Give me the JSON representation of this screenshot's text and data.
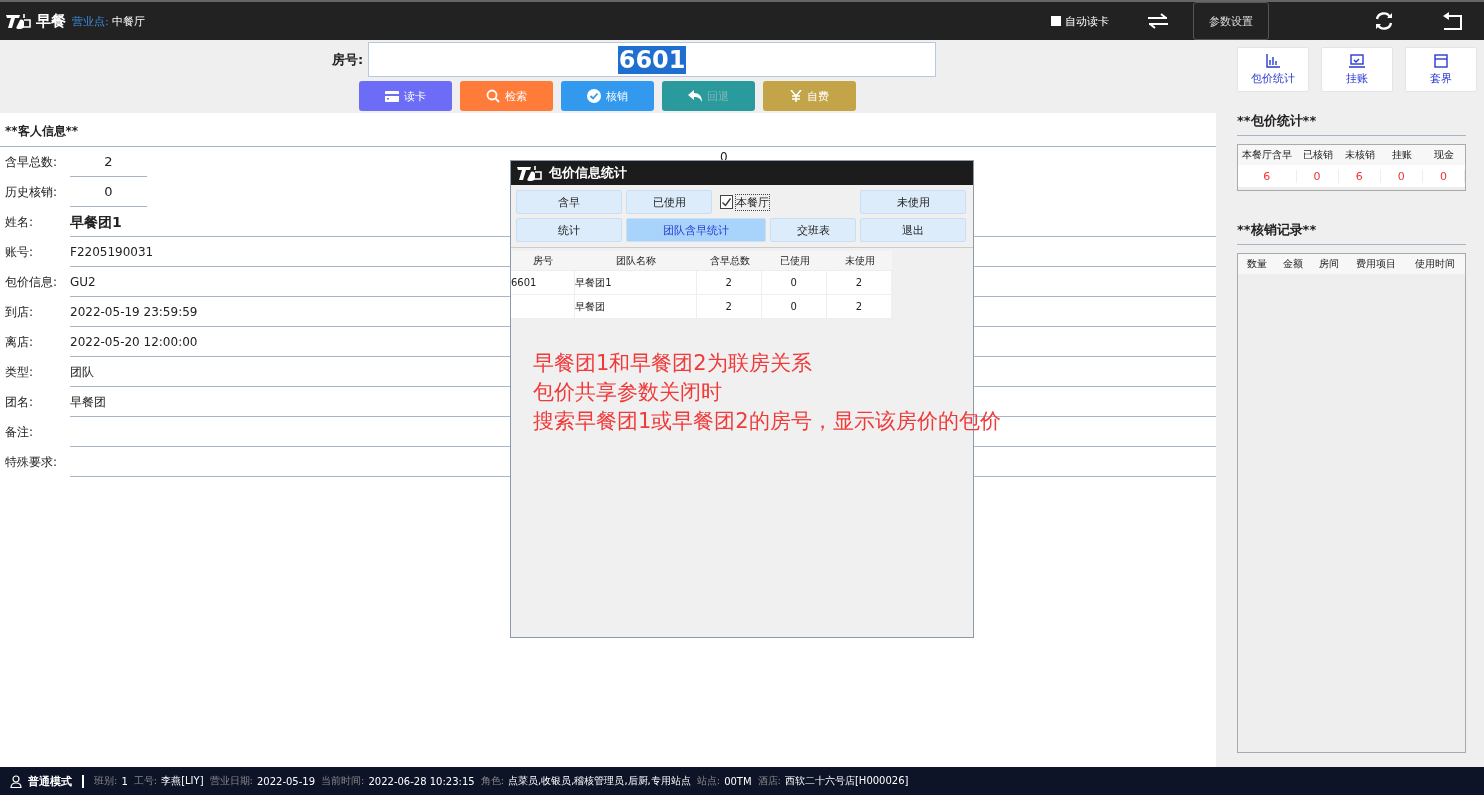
{
  "topbar": {
    "logo_text": "早餐",
    "outlet_label": "营业点:",
    "outlet": "中餐厅",
    "auto_read": {
      "label": "自动读卡",
      "checked": false
    },
    "settings_button": "参数设置"
  },
  "room": {
    "label": "房号:",
    "value": "6601"
  },
  "actions": [
    {
      "label": "读卡",
      "color": "#6c6cf7",
      "disabled": false
    },
    {
      "label": "检索",
      "color": "#ff7b3a",
      "disabled": false
    },
    {
      "label": "核销",
      "color": "#3399ee",
      "disabled": false
    },
    {
      "label": "回退",
      "color": "#2b9a9c",
      "disabled": true
    },
    {
      "label": "自费",
      "color": "#c4a448",
      "disabled": false
    }
  ],
  "quick_buttons": [
    {
      "label": "包价统计"
    },
    {
      "label": "挂账"
    },
    {
      "label": "套界"
    }
  ],
  "guest_info": {
    "title": "**客人信息**",
    "counters": [
      {
        "label": "含早总数:",
        "value": "2"
      },
      {
        "label": "历史核销:",
        "value": "0"
      }
    ],
    "today": {
      "value": "0"
    },
    "fields": [
      {
        "label": "姓名:",
        "value": "早餐团1",
        "kind": "bold"
      },
      {
        "label": "账号:",
        "value": "F2205190031",
        "kind": "plain"
      },
      {
        "label": "包价信息:",
        "value": "GU2",
        "kind": "plain"
      },
      {
        "label": "到店:",
        "value": "2022-05-19 23:59:59",
        "kind": "plain"
      },
      {
        "label": "离店:",
        "value": "2022-05-20 12:00:00",
        "kind": "plain"
      },
      {
        "label": "类型:",
        "value": "团队",
        "kind": "plain"
      },
      {
        "label": "团名:",
        "value": "早餐团",
        "kind": "plain"
      },
      {
        "label": "备注:",
        "kind": "plain"
      },
      {
        "label": "特殊要求:",
        "kind": "plain"
      }
    ]
  },
  "package_stats": {
    "title": "**包价统计**",
    "columns": [
      "本餐厅含早",
      "已核销",
      "未核销",
      "挂账",
      "现金"
    ],
    "values": [
      "6",
      "0",
      "6",
      "0",
      "0"
    ]
  },
  "writeoff_records": {
    "title": "**核销记录**",
    "columns": [
      "数量",
      "金额",
      "房间",
      "费用项目",
      "使用时间"
    ]
  },
  "dialog": {
    "title": "包价信息统计",
    "buttons": [
      {
        "label": "含早",
        "selected": false
      },
      {
        "label": "已使用",
        "selected": false
      },
      {
        "label": "未使用",
        "selected": false
      },
      {
        "label": "统计",
        "selected": false
      },
      {
        "label": "团队含早统计",
        "selected": true
      },
      {
        "label": "交班表",
        "selected": false
      },
      {
        "label": "退出",
        "selected": false
      }
    ],
    "checkbox": {
      "label": "本餐厅",
      "checked": true
    },
    "table": {
      "columns": [
        "房号",
        "团队名称",
        "含早总数",
        "已使用",
        "未使用"
      ],
      "rows": [
        [
          "6601",
          "早餐团1",
          "2",
          "0",
          "2"
        ],
        [
          "",
          "早餐团",
          "2",
          "0",
          "2"
        ]
      ]
    },
    "note": [
      "早餐团1和早餐团2为联房关系",
      "包价共享参数关闭时",
      "搜索早餐团1或早餐团2的房号，显示该房价的包价"
    ]
  },
  "status_bar": {
    "mode": "普通模式",
    "items": [
      {
        "label": "班别:",
        "value": "1"
      },
      {
        "label": "工号:",
        "value": "李燕[LIY]"
      },
      {
        "label": "营业日期:",
        "value": "2022-05-19"
      },
      {
        "label": "当前时间:",
        "value": "2022-06-28 10:23:15"
      },
      {
        "label": "角色:",
        "value": "点菜员,收银员,稽核管理员,后厨,专用站点"
      },
      {
        "label": "站点:",
        "value": "00TM"
      },
      {
        "label": "酒店:",
        "value": "西软二十六号店[H000026]"
      }
    ]
  }
}
